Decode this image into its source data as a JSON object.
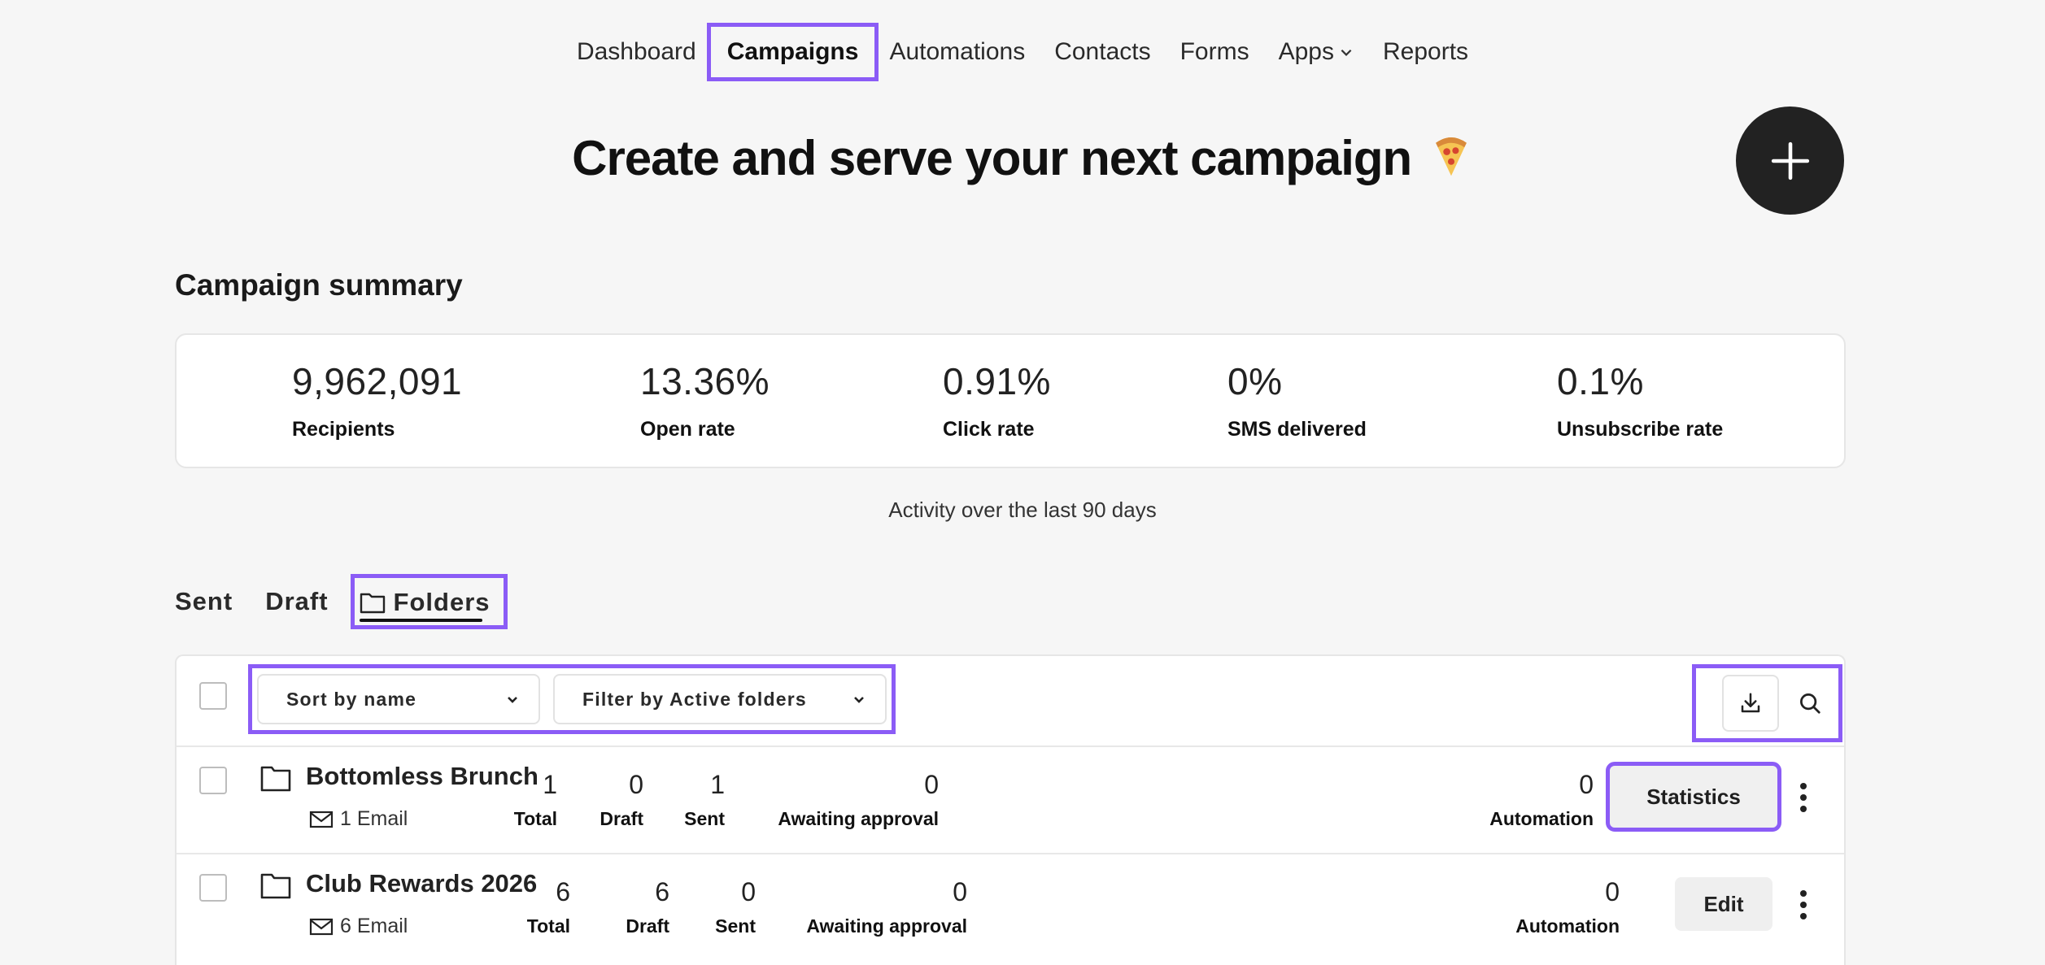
{
  "nav": {
    "items": [
      {
        "label": "Dashboard"
      },
      {
        "label": "Campaigns",
        "active": true
      },
      {
        "label": "Automations"
      },
      {
        "label": "Contacts"
      },
      {
        "label": "Forms"
      },
      {
        "label": "Apps",
        "has_dropdown": true
      },
      {
        "label": "Reports"
      }
    ]
  },
  "hero": {
    "title": "Create and serve your next campaign",
    "emoji_icon": "pizza-icon",
    "add_button_icon": "plus-icon"
  },
  "summary": {
    "title": "Campaign summary",
    "metrics": [
      {
        "value": "9,962,091",
        "label": "Recipients"
      },
      {
        "value": "13.36%",
        "label": "Open rate"
      },
      {
        "value": "0.91%",
        "label": "Click rate"
      },
      {
        "value": "0%",
        "label": "SMS delivered"
      },
      {
        "value": "0.1%",
        "label": "Unsubscribe rate"
      }
    ],
    "activity_note": "Activity over the last 90 days"
  },
  "tabs": {
    "items": [
      {
        "label": "Sent"
      },
      {
        "label": "Draft"
      },
      {
        "label": "Folders",
        "active": true,
        "icon": "folder-icon"
      }
    ]
  },
  "toolbar": {
    "sort_label": "Sort by name",
    "filter_label": "Filter by Active folders",
    "download_icon": "download-icon",
    "search_icon": "search-icon"
  },
  "folders": [
    {
      "name": "Bottomless Brunch",
      "email_count": "1 Email",
      "stats": [
        {
          "value": "1",
          "label": "Total"
        },
        {
          "value": "0",
          "label": "Draft"
        },
        {
          "value": "1",
          "label": "Sent"
        },
        {
          "value": "0",
          "label": "Awaiting approval"
        },
        {
          "value": "0",
          "label": "Automation"
        }
      ],
      "action_label": "Statistics"
    },
    {
      "name": "Club Rewards 2026",
      "email_count": "6 Email",
      "stats": [
        {
          "value": "6",
          "label": "Total"
        },
        {
          "value": "6",
          "label": "Draft"
        },
        {
          "value": "0",
          "label": "Sent"
        },
        {
          "value": "0",
          "label": "Awaiting approval"
        },
        {
          "value": "0",
          "label": "Automation"
        }
      ],
      "action_label": "Edit"
    }
  ],
  "colors": {
    "highlight": "#8b5cf6",
    "background": "#f6f6f6",
    "fab": "#222222"
  }
}
